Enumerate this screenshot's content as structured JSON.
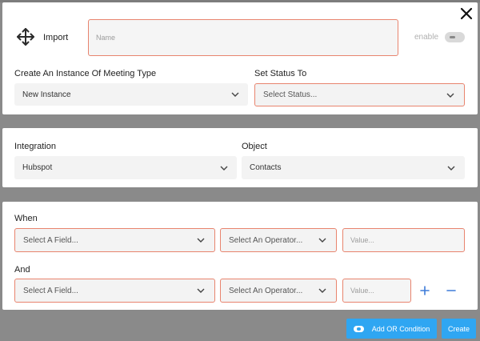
{
  "dialog": {
    "import_label": "Import",
    "name_placeholder": "Name",
    "name_value": "",
    "enable_label": "enable"
  },
  "meeting": {
    "instance_label": "Create An Instance Of Meeting Type",
    "instance_value": "New Instance",
    "status_label": "Set Status To",
    "status_placeholder": "Select Status..."
  },
  "integration": {
    "integration_label": "Integration",
    "integration_value": "Hubspot",
    "object_label": "Object",
    "object_value": "Contacts"
  },
  "conditions": {
    "when_label": "When",
    "and_label": "And",
    "field_placeholder": "Select A Field...",
    "operator_placeholder": "Select An Operator...",
    "value_placeholder": "Value..."
  },
  "footer": {
    "add_or_label": "Add OR Condition",
    "create_label": "Create"
  },
  "colors": {
    "accent": "#2fa6f2",
    "error_border": "#e8846e",
    "plus_minus": "#3d7bd9"
  },
  "icons": {
    "close": "close-icon",
    "import": "move-arrows-icon",
    "chevron": "chevron-down-icon",
    "plus": "plus-icon",
    "minus": "minus-icon"
  }
}
